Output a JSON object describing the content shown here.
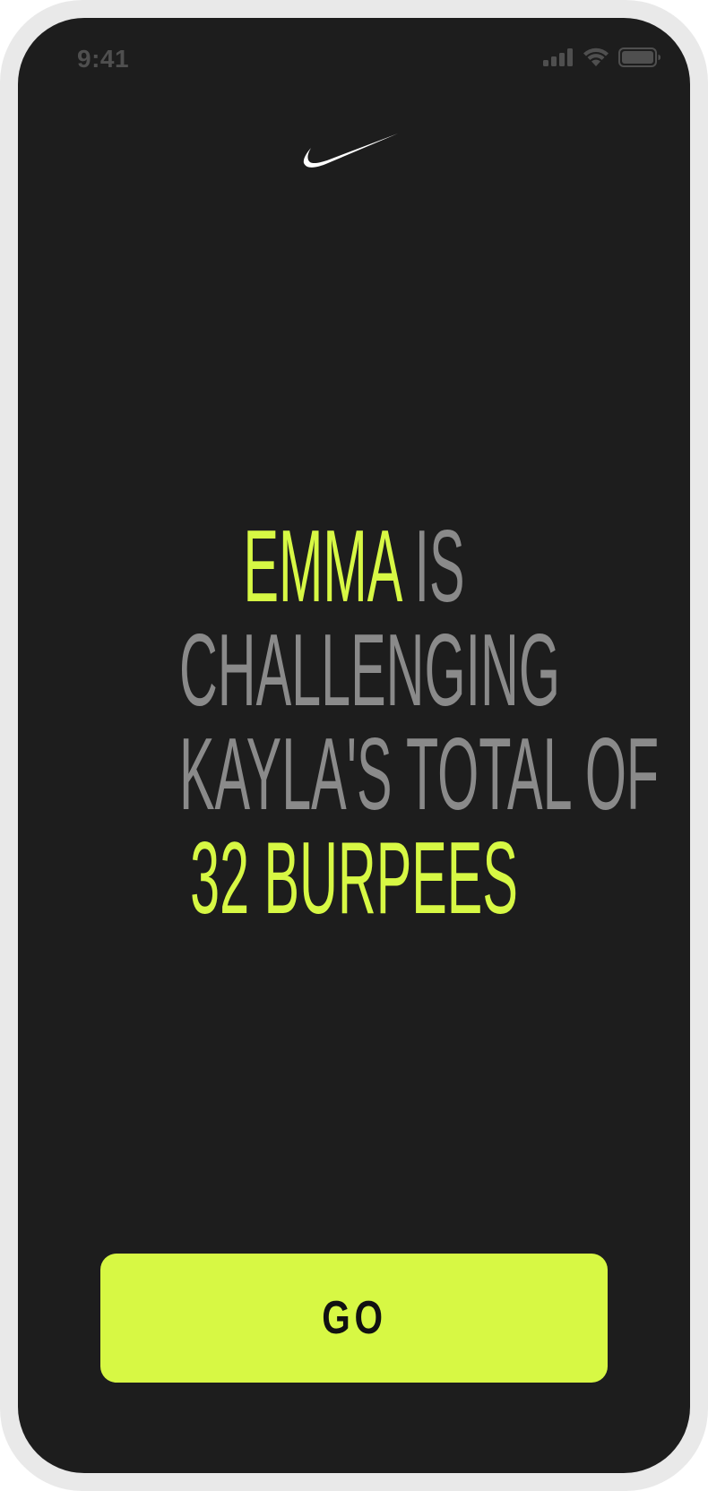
{
  "status_bar": {
    "time": "9:41",
    "signal_icon": "cellular-signal-icon",
    "wifi_icon": "wifi-icon",
    "battery_icon": "battery-icon"
  },
  "logo": {
    "icon": "nike-swoosh-logo"
  },
  "headline": {
    "challenger": "Emma",
    "text_1": " is",
    "line_2": "challenging",
    "line_3": "Kayla's total of",
    "count_line": "32 burpees"
  },
  "action": {
    "label": "GO"
  },
  "colors": {
    "background": "#1d1d1d",
    "accent": "#d7f844",
    "muted_text": "#8a8a8a",
    "frame": "#e9e9e9"
  }
}
